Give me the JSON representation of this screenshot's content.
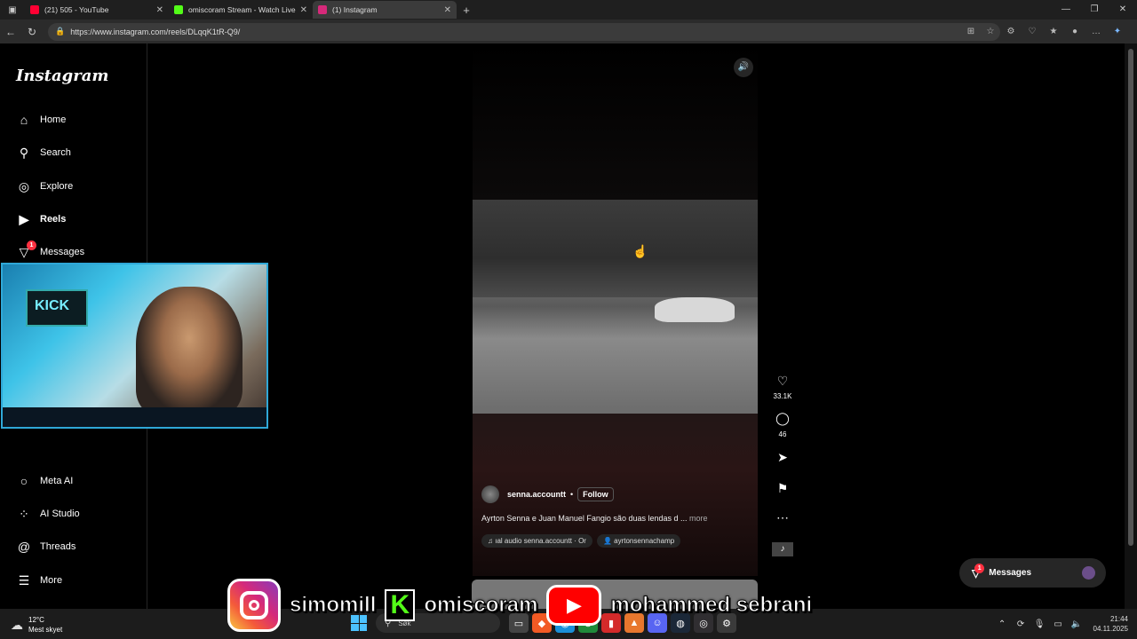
{
  "browser": {
    "tabs": [
      {
        "title": "(21) 505 - YouTube",
        "favicon_color": "#ff0033",
        "active": false
      },
      {
        "title": "omiscoram Stream - Watch Live o",
        "favicon_color": "#53fc18",
        "active": false
      },
      {
        "title": "(1) Instagram",
        "favicon_color": "#d6297a",
        "active": true
      }
    ],
    "new_tab": "+",
    "url": "https://www.instagram.com/reels/DLqqK1tR-Q9/"
  },
  "sidebar": {
    "logo": "Instagram",
    "items": [
      {
        "label": "Home",
        "icon": "⌂"
      },
      {
        "label": "Search",
        "icon": "⚲"
      },
      {
        "label": "Explore",
        "icon": "◎"
      },
      {
        "label": "Reels",
        "icon": "▶"
      },
      {
        "label": "Messages",
        "icon": "▽",
        "badge": "1"
      },
      {
        "label": "Meta AI",
        "icon": "○"
      },
      {
        "label": "AI Studio",
        "icon": "⁘"
      },
      {
        "label": "Threads",
        "icon": "@"
      },
      {
        "label": "More",
        "icon": "☰"
      }
    ]
  },
  "reel": {
    "mute_icon": "🔊",
    "likes": "33.1K",
    "comments": "46",
    "username": "senna.accountt",
    "dot": "•",
    "follow": "Follow",
    "caption": "Ayrton Senna e Juan Manuel Fangio são duas lendas d ...",
    "more": "more",
    "audio": "♫ ıal audio  senna.accountt · Or",
    "tag": "👤 ayrtonsennachamp"
  },
  "messages_pill": {
    "label": "Messages",
    "badge": "1"
  },
  "stream_overlay": {
    "handles": [
      "simomill",
      "omiscoram",
      "mohammed sebrani"
    ],
    "kick_letter": "K",
    "youtube_icon": "▶"
  },
  "taskbar": {
    "temperature": "12°C",
    "weather": "Mest skyet",
    "search": "Søk",
    "time": "21:44",
    "date": "04.11.2025"
  }
}
